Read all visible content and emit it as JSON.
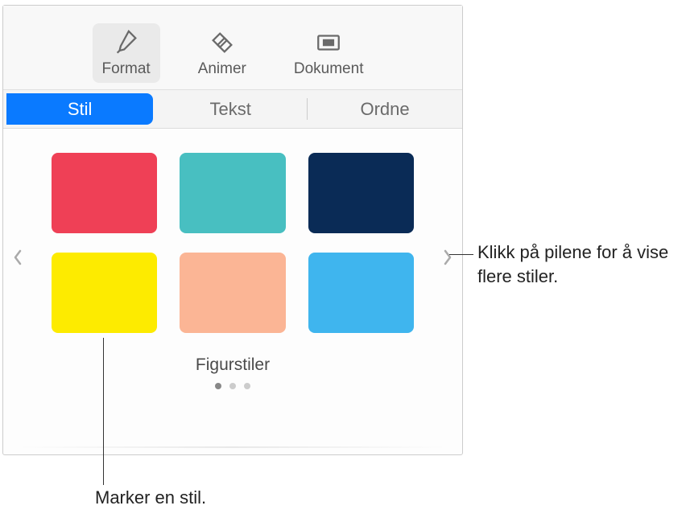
{
  "top_tabs": {
    "format": "Format",
    "animate": "Animer",
    "document": "Dokument"
  },
  "sub_tabs": {
    "style": "Stil",
    "text": "Tekst",
    "arrange": "Ordne"
  },
  "styles_section": {
    "title": "Figurstiler"
  },
  "swatches": [
    {
      "color": "#ef4056"
    },
    {
      "color": "#48bfc1"
    },
    {
      "color": "#0a2b56"
    },
    {
      "color": "#fdeb00"
    },
    {
      "color": "#fbb595"
    },
    {
      "color": "#3fb5ee"
    }
  ],
  "callouts": {
    "right": "Klikk på pilene for å vise flere stiler.",
    "bottom": "Marker en stil."
  }
}
